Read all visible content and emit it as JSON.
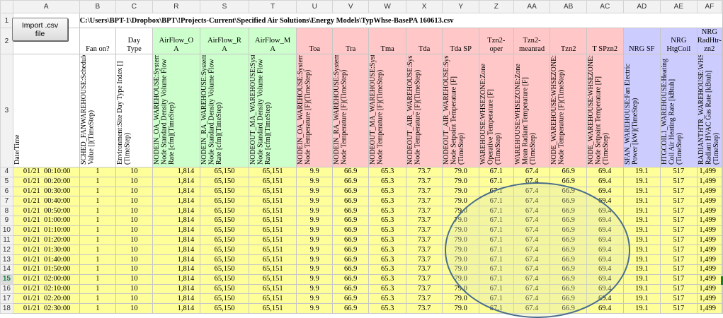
{
  "button": {
    "label_line1": "Import .csv",
    "label_line2": "file"
  },
  "file_path": "C:\\Users\\BPT-1\\Dropbox\\BPT\\!Projects-Current\\Specified Air Solutions\\Energy Models\\TypWhse-BasePA 160613.csv",
  "columns": [
    "A",
    "B",
    "C",
    "R",
    "S",
    "T",
    "U",
    "V",
    "W",
    "X",
    "Y",
    "Z",
    "AA",
    "AB",
    "AC",
    "AD",
    "AE",
    "AF"
  ],
  "row_numbers": [
    "1",
    "2",
    "3",
    "4",
    "5",
    "6",
    "7",
    "8",
    "9",
    "10",
    "11",
    "12",
    "13",
    "14",
    "15",
    "16",
    "17",
    "18"
  ],
  "selected_row": "15",
  "headers": [
    {
      "short": [
        ""
      ],
      "long": "Date/Time"
    },
    {
      "short": [
        "Fan on?"
      ],
      "long": "SCHED_FANWAREHOUSE:Schedule Value [](TimeStep)"
    },
    {
      "short": [
        "Day",
        "Type"
      ],
      "long": "Environment:Site Day Type Index [](TimeStep)"
    },
    {
      "short": [
        "AirFlow_O",
        "A"
      ],
      "long": "NODEIN_OA_WAREHOUSE:System Node Standard Density Volume Flow Rate [cfm](TimeStep)"
    },
    {
      "short": [
        "AirFlow_R",
        "A"
      ],
      "long": "NODEIN_RA_WAREHOUSE:System Node Standard Density Volume Flow Rate [cfm](TimeStep)"
    },
    {
      "short": [
        "AirFlow_M",
        "A"
      ],
      "long": "NODEOUT_MA_WAREHOUSE:System Node Standard Density Volume Flow Rate [cfm](TimeStep)"
    },
    {
      "short": [
        "Toa"
      ],
      "long": "NODEIN_OA_WAREHOUSE:System Node Temperature [F](TimeStep)"
    },
    {
      "short": [
        "Tra"
      ],
      "long": "NODEIN_RA_WAREHOUSE:System Node Temperature [F](TimeStep)"
    },
    {
      "short": [
        "Tma"
      ],
      "long": "NODEOUT_MA_WAREHOUSE:System Node Temperature [F](TimeStep)"
    },
    {
      "short": [
        "Tda"
      ],
      "long": "NODEOUT_AIR_WAREHOUSE:System Node Temperature [F](TimeStep)"
    },
    {
      "short": [
        "Tda SP"
      ],
      "long": "NODEOUT_AIR_WAREHOUSE:System Node Setpoint Temperature [F](TimeStep)"
    },
    {
      "short": [
        "Tzn2-",
        "oper"
      ],
      "long": "WAREHOUSE:WHSEZONE:Zone Operative Temperature [F](TimeStep)"
    },
    {
      "short": [
        "Tzn2-",
        "meanrad"
      ],
      "long": "WAREHOUSE:WHSEZONE:Zone Mean Radiant Temperature [F](TimeStep)"
    },
    {
      "short": [
        "Tzn2"
      ],
      "long": "NODE_WAREHOUSE:WHSEZONE:System Node Temperature [F](TimeStep)"
    },
    {
      "short": [
        "T SPzn2"
      ],
      "long": "NODE_WAREHOUSE:WHSEZONE:System Node Setpoint Temperature [F](TimeStep)"
    },
    {
      "short": [
        "NRG SF"
      ],
      "long": "SFAN_WAREHOUSE:Fan Electric Power [kW](TimeStep)"
    },
    {
      "short": [
        "NRG",
        "HtgCoil"
      ],
      "long": "HTGCOIL1_WAREHOUSE:Heating Coil Air Heating Rate [kBtuh](TimeStep)"
    },
    {
      "short": [
        "NRG",
        "RadHtr-",
        "zn2"
      ],
      "long": "RADIANTHTR_WAREHOUSE:WHSEZONE:Zone Radiant HVAC Gas Rate [kBtuh](TimeStep)"
    }
  ],
  "rows": [
    [
      "01/21  00:10:00",
      "1",
      "10",
      "1,814",
      "65,150",
      "65,151",
      "9.9",
      "66.9",
      "65.3",
      "73.7",
      "79.0",
      "67.1",
      "67.4",
      "66.9",
      "69.4",
      "19.1",
      "517",
      "1,499"
    ],
    [
      "01/21  00:20:00",
      "1",
      "10",
      "1,814",
      "65,150",
      "65,151",
      "9.9",
      "66.9",
      "65.3",
      "73.7",
      "79.0",
      "67.1",
      "67.4",
      "66.9",
      "69.4",
      "19.1",
      "517",
      "1,499"
    ],
    [
      "01/21  00:30:00",
      "1",
      "10",
      "1,814",
      "65,150",
      "65,151",
      "9.9",
      "66.9",
      "65.3",
      "73.7",
      "79.0",
      "67.1",
      "67.4",
      "66.9",
      "69.4",
      "19.1",
      "517",
      "1,499"
    ],
    [
      "01/21  00:40:00",
      "1",
      "10",
      "1,814",
      "65,150",
      "65,151",
      "9.9",
      "66.9",
      "65.3",
      "73.7",
      "79.0",
      "67.1",
      "67.4",
      "66.9",
      "69.4",
      "19.1",
      "517",
      "1,499"
    ],
    [
      "01/21  00:50:00",
      "1",
      "10",
      "1,814",
      "65,150",
      "65,151",
      "9.9",
      "66.9",
      "65.3",
      "73.7",
      "79.0",
      "67.1",
      "67.4",
      "66.9",
      "69.4",
      "19.1",
      "517",
      "1,499"
    ],
    [
      "01/21  01:00:00",
      "1",
      "10",
      "1,814",
      "65,150",
      "65,151",
      "9.9",
      "66.9",
      "65.3",
      "73.7",
      "79.0",
      "67.1",
      "67.4",
      "66.9",
      "69.4",
      "19.1",
      "517",
      "1,499"
    ],
    [
      "01/21  01:10:00",
      "1",
      "10",
      "1,814",
      "65,150",
      "65,151",
      "9.9",
      "66.9",
      "65.3",
      "73.7",
      "79.0",
      "67.1",
      "67.4",
      "66.9",
      "69.4",
      "19.1",
      "517",
      "1,499"
    ],
    [
      "01/21  01:20:00",
      "1",
      "10",
      "1,814",
      "65,150",
      "65,151",
      "9.9",
      "66.9",
      "65.3",
      "73.7",
      "79.0",
      "67.1",
      "67.4",
      "66.9",
      "69.4",
      "19.1",
      "517",
      "1,499"
    ],
    [
      "01/21  01:30:00",
      "1",
      "10",
      "1,814",
      "65,150",
      "65,151",
      "9.9",
      "66.9",
      "65.3",
      "73.7",
      "79.0",
      "67.1",
      "67.4",
      "66.9",
      "69.4",
      "19.1",
      "517",
      "1,499"
    ],
    [
      "01/21  01:40:00",
      "1",
      "10",
      "1,814",
      "65,150",
      "65,151",
      "9.9",
      "66.9",
      "65.3",
      "73.7",
      "79.0",
      "67.1",
      "67.4",
      "66.9",
      "69.4",
      "19.1",
      "517",
      "1,499"
    ],
    [
      "01/21  01:50:00",
      "1",
      "10",
      "1,814",
      "65,150",
      "65,151",
      "9.9",
      "66.9",
      "65.3",
      "73.7",
      "79.0",
      "67.1",
      "67.4",
      "66.9",
      "69.4",
      "19.1",
      "517",
      "1,499"
    ],
    [
      "01/21  02:00:00",
      "1",
      "10",
      "1,814",
      "65,150",
      "65,151",
      "9.9",
      "66.9",
      "65.3",
      "73.7",
      "79.0",
      "67.1",
      "67.4",
      "66.9",
      "69.4",
      "19.1",
      "517",
      "1,499"
    ],
    [
      "01/21  02:10:00",
      "1",
      "10",
      "1,814",
      "65,150",
      "65,151",
      "9.9",
      "66.9",
      "65.3",
      "73.7",
      "79.0",
      "67.1",
      "67.4",
      "66.9",
      "69.4",
      "19.1",
      "517",
      "1,499"
    ],
    [
      "01/21  02:20:00",
      "1",
      "10",
      "1,814",
      "65,150",
      "65,151",
      "9.9",
      "66.9",
      "65.3",
      "73.7",
      "79.0",
      "67.1",
      "67.4",
      "66.9",
      "69.4",
      "19.1",
      "517",
      "1,499"
    ],
    [
      "01/21  02:30:00",
      "1",
      "10",
      "1,814",
      "65,150",
      "65,151",
      "9.9",
      "66.9",
      "65.3",
      "73.7",
      "79.0",
      "67.1",
      "67.4",
      "66.9",
      "69.4",
      "19.1",
      "517",
      "1,499"
    ]
  ],
  "colors": {
    "green_header": "#ccffcc",
    "pink_header": "#ffc7c7",
    "blue_header": "#ccccff",
    "data_fill": "#ffff99",
    "title_red": "#c00000",
    "annotation_outline": "#4a6d8c"
  }
}
